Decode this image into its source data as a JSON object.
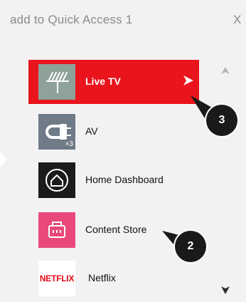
{
  "header": {
    "title": "add to Quick Access 1",
    "close_label": "X"
  },
  "items": [
    {
      "label": "Live TV",
      "icon": "antenna-icon",
      "selected": true
    },
    {
      "label": "AV",
      "icon": "av-cable-icon",
      "badge": "×3"
    },
    {
      "label": "Home Dashboard",
      "icon": "home-dashboard-icon"
    },
    {
      "label": "Content Store",
      "icon": "content-store-icon"
    },
    {
      "label": "Netflix",
      "icon": "netflix-logo",
      "logo_text": "NETFLIX"
    }
  ],
  "callouts": [
    {
      "number": "3"
    },
    {
      "number": "2"
    }
  ],
  "colors": {
    "panel_bg": "#f2f2f2",
    "selected_bg": "#e9141c",
    "live_tv_tile": "#8ea29a",
    "av_tile": "#6f7b86",
    "home_tile": "#1b1b1b",
    "content_store_tile": "#e8497a",
    "netflix_red": "#e50914",
    "callout_bg": "#1a1a1a"
  }
}
